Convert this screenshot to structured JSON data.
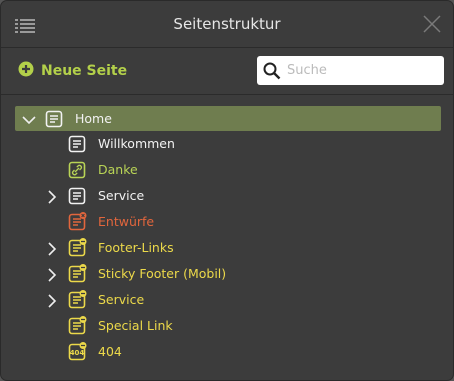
{
  "dialog": {
    "title": "Seitenstruktur",
    "new_page_label": "Neue Seite",
    "search_placeholder": "Suche"
  },
  "tree": [
    {
      "label": "Home",
      "level": 0,
      "expanded": true,
      "selected": true,
      "icon": "page-icon",
      "color": "#f2f2f2"
    },
    {
      "label": "Willkommen",
      "level": 1,
      "icon": "page-icon",
      "color": "#f2f2f2"
    },
    {
      "label": "Danke",
      "level": 1,
      "icon": "link-icon",
      "color": "#b9d456"
    },
    {
      "label": "Service",
      "level": 1,
      "collapsed": true,
      "icon": "page-icon",
      "color": "#f2f2f2"
    },
    {
      "label": "Entwürfe",
      "level": 1,
      "icon": "draft-page-icon",
      "color": "#e2663d"
    },
    {
      "label": "Footer-Links",
      "level": 1,
      "collapsed": true,
      "icon": "hidden-page-icon",
      "color": "#ecd94a"
    },
    {
      "label": "Sticky Footer (Mobil)",
      "level": 1,
      "collapsed": true,
      "icon": "hidden-page-icon",
      "color": "#ecd94a"
    },
    {
      "label": "Service",
      "level": 1,
      "collapsed": true,
      "icon": "hidden-page-icon",
      "color": "#ecd94a"
    },
    {
      "label": "Special Link",
      "level": 1,
      "icon": "hidden-page-icon",
      "color": "#ecd94a"
    },
    {
      "label": "404",
      "level": 1,
      "icon": "error-page-icon",
      "color": "#ecd94a"
    }
  ]
}
